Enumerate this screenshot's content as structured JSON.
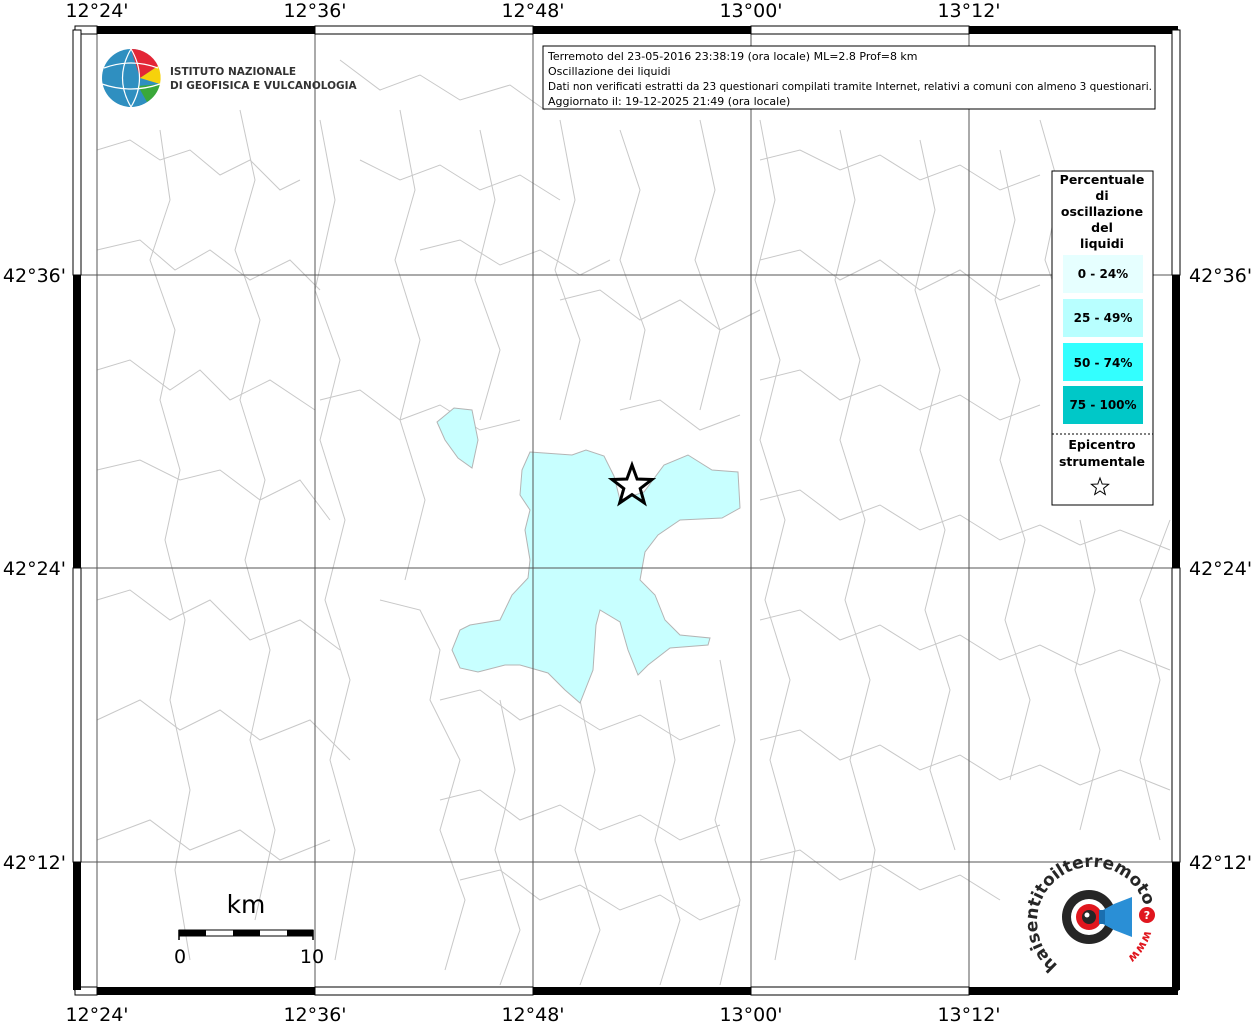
{
  "map": {
    "lon_labels": [
      "12°24'",
      "12°36'",
      "12°48'",
      "13°00'",
      "13°12'"
    ],
    "lat_labels": [
      "42°36'",
      "42°24'",
      "42°12'"
    ],
    "info_box": {
      "line1": "Terremoto del 23-05-2016 23:38:19 (ora locale) ML=2.8 Prof=8 km",
      "line2": "Oscillazione dei liquidi",
      "line3": "Dati non verificati estratti da 23 questionari compilati tramite Internet, relativi a comuni con almeno 3 questionari.",
      "line4": "Aggiornato il: 19-12-2025 21:49 (ora locale)"
    },
    "logo": {
      "line1": "ISTITUTO NAZIONALE",
      "line2": "DI GEOFISICA E VULCANOLOGIA"
    },
    "legend": {
      "title_lines": [
        "Percentuale",
        "di",
        "oscillazione",
        "del",
        "liquidi"
      ],
      "classes": [
        {
          "label": "0 - 24%",
          "color": "#e6ffff"
        },
        {
          "label": "25 - 49%",
          "color": "#b8ffff"
        },
        {
          "label": "50 - 74%",
          "color": "#33ffff"
        },
        {
          "label": "75 - 100%",
          "color": "#00c8c8"
        }
      ],
      "epicenter_lines": [
        "Epicentro",
        "strumentale"
      ]
    },
    "scale_bar": {
      "unit": "km",
      "min": "0",
      "max": "10"
    },
    "watermark": {
      "text": "haisentitoilterremoto.it",
      "url": "www"
    },
    "highlight_color": "#c8ffff",
    "boundary_color": "#c8c8c8"
  }
}
